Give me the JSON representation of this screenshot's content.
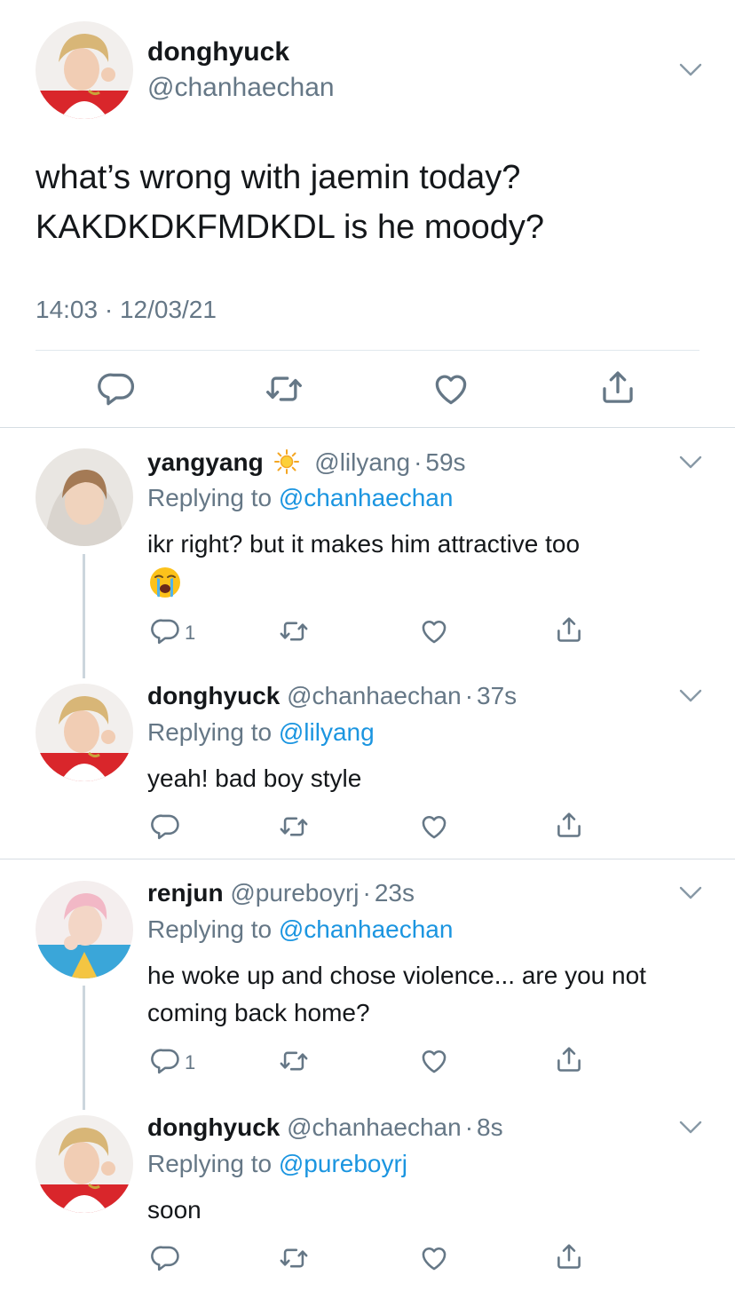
{
  "main": {
    "name": "donghyuck",
    "handle": "@chanhaechan",
    "text_line1": "what’s wrong with jaemin today?",
    "text_line2": "KAKDKDKFMDKDL is he moody?",
    "timestamp": "14:03 · 12/03/21"
  },
  "replies": [
    {
      "name": "yangyang",
      "name_emoji": "sun-emoji",
      "handle": "@lilyang",
      "time": "59s",
      "replying_prefix": "Replying to",
      "replying_to": "@chanhaechan",
      "text": "ikr right? but it makes him attractive too",
      "reply_count": "1"
    },
    {
      "name": "donghyuck",
      "handle": "@chanhaechan",
      "time": "37s",
      "replying_prefix": "Replying to",
      "replying_to": "@lilyang",
      "text": "yeah! bad boy style",
      "reply_count": ""
    },
    {
      "name": "renjun",
      "handle": "@pureboyrj",
      "time": "23s",
      "replying_prefix": "Replying to",
      "replying_to": "@chanhaechan",
      "text": "he woke up and chose violence... are you not coming back home?",
      "reply_count": "1"
    },
    {
      "name": "donghyuck",
      "handle": "@chanhaechan",
      "time": "8s",
      "replying_prefix": "Replying to",
      "replying_to": "@pureboyrj",
      "text": "soon",
      "reply_count": ""
    }
  ],
  "separator": "·",
  "colors": {
    "text_primary": "#14171a",
    "text_secondary": "#657786",
    "link": "#1b95e0",
    "divider": "#e1e8ed",
    "thread_line": "#ccd6dd"
  },
  "icons": [
    "reply-icon",
    "retweet-icon",
    "like-icon",
    "share-icon",
    "chevron-down-icon",
    "crying-emoji",
    "sun-emoji"
  ]
}
